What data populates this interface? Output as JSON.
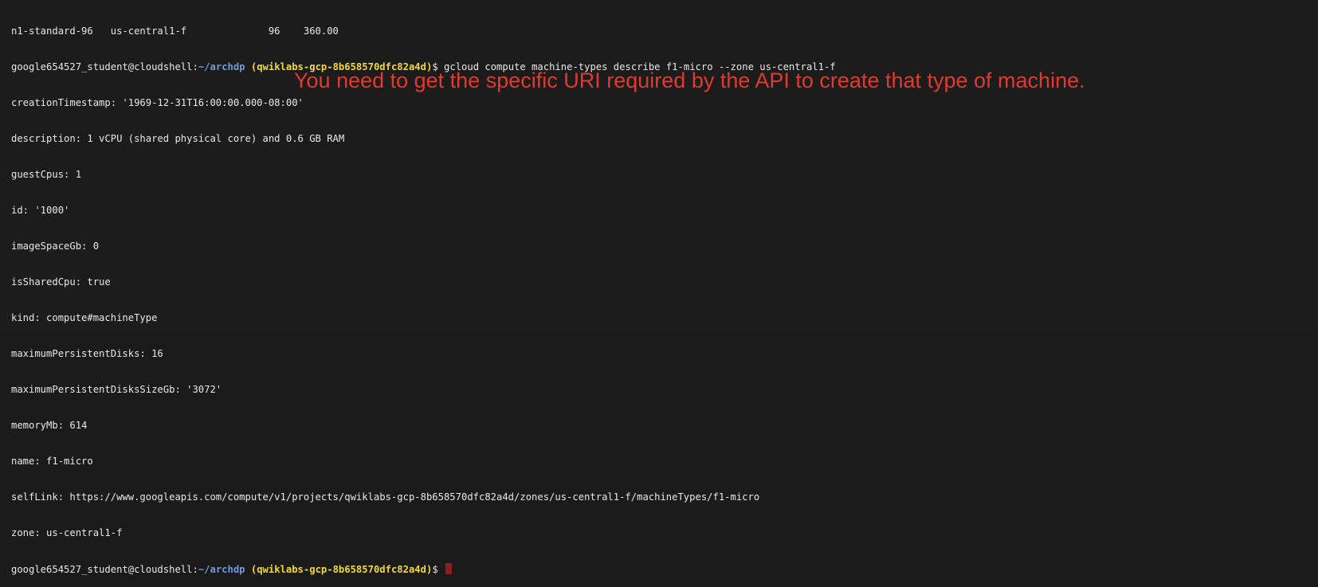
{
  "terminal": {
    "header_line": "n1-standard-96   us-central1-f              96    360.00",
    "prompt": {
      "user_host": "google654527_student@cloudshell:",
      "path": "~/archdp",
      "project": "(qwiklabs-gcp-8b658570dfc82a4d)",
      "symbol": "$ "
    },
    "command": "gcloud compute machine-types describe f1-micro --zone us-central1-f",
    "output": [
      "creationTimestamp: '1969-12-31T16:00:00.000-08:00'",
      "description: 1 vCPU (shared physical core) and 0.6 GB RAM",
      "guestCpus: 1",
      "id: '1000'",
      "imageSpaceGb: 0",
      "isSharedCpu: true",
      "kind: compute#machineType",
      "maximumPersistentDisks: 16",
      "maximumPersistentDisksSizeGb: '3072'",
      "memoryMb: 614",
      "name: f1-micro",
      "selfLink: https://www.googleapis.com/compute/v1/projects/qwiklabs-gcp-8b658570dfc82a4d/zones/us-central1-f/machineTypes/f1-micro",
      "zone: us-central1-f"
    ]
  },
  "annotation": {
    "text": "You need to get the specific URI required by the API to create that type of machine."
  },
  "colors": {
    "background": "#1c1c1c",
    "text": "#e8e8e8",
    "path": "#6f9bd8",
    "project": "#f0d83a",
    "annotation": "#e03a2e",
    "cursor": "#8b1e1e"
  }
}
